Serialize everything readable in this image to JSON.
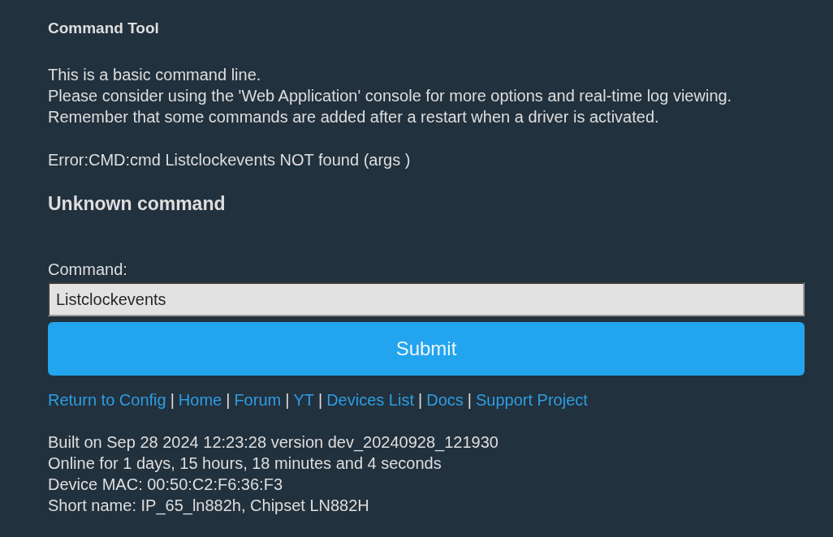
{
  "page": {
    "title": "Command Tool"
  },
  "intro": [
    "This is a basic command line.",
    "Please consider using the 'Web Application' console for more options and real-time log viewing.",
    "Remember that some commands are added after a restart when a driver is activated."
  ],
  "error_message": "Error:CMD:cmd Listclockevents NOT found (args )",
  "result_heading": "Unknown command",
  "command_form": {
    "label": "Command:",
    "value": "Listclockevents",
    "submit_label": "Submit"
  },
  "links": {
    "separator": "|",
    "items": [
      "Return to Config",
      "Home",
      "Forum",
      "YT",
      "Devices List",
      "Docs",
      "Support Project"
    ]
  },
  "info": [
    "Built on Sep 28 2024 12:23:28 version dev_20240928_121930",
    "Online for 1 days, 15 hours, 18 minutes and 4 seconds",
    "Device MAC: 00:50:C2:F6:36:F3",
    "Short name: IP_65_ln882h, Chipset LN882H"
  ]
}
